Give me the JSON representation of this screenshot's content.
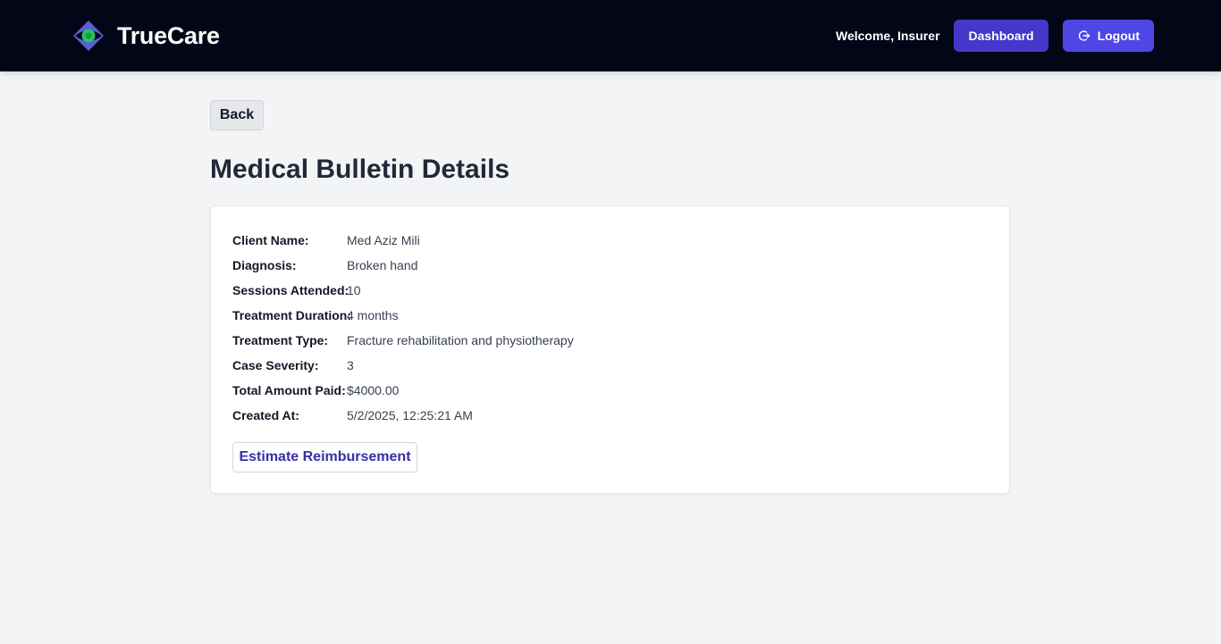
{
  "header": {
    "brand_name": "TrueCare",
    "logo_icon": "truecare-logo-icon",
    "welcome_text": "Welcome, Insurer",
    "dashboard_label": "Dashboard",
    "logout_label": "Logout",
    "logout_icon": "logout-icon",
    "colors": {
      "background": "#030616",
      "dashboard": "#4338ca",
      "logout": "#4f46e5",
      "logo_blue": "#5b5fd6",
      "logo_green": "#22c55e"
    }
  },
  "page": {
    "back_label": "Back",
    "title": "Medical Bulletin Details"
  },
  "details": [
    {
      "label": "Client Name:",
      "value": "Med Aziz Mili"
    },
    {
      "label": "Diagnosis:",
      "value": "Broken hand"
    },
    {
      "label": "Sessions Attended:",
      "value": "10"
    },
    {
      "label": "Treatment Duration:",
      "value": "4 months"
    },
    {
      "label": "Treatment Type:",
      "value": "Fracture rehabilitation and physiotherapy"
    },
    {
      "label": "Case Severity:",
      "value": "3"
    },
    {
      "label": "Total Amount Paid:",
      "value": "$4000.00"
    },
    {
      "label": "Created At:",
      "value": "5/2/2025, 12:25:21 AM"
    }
  ],
  "actions": {
    "estimate_label": "Estimate Reimbursement"
  }
}
